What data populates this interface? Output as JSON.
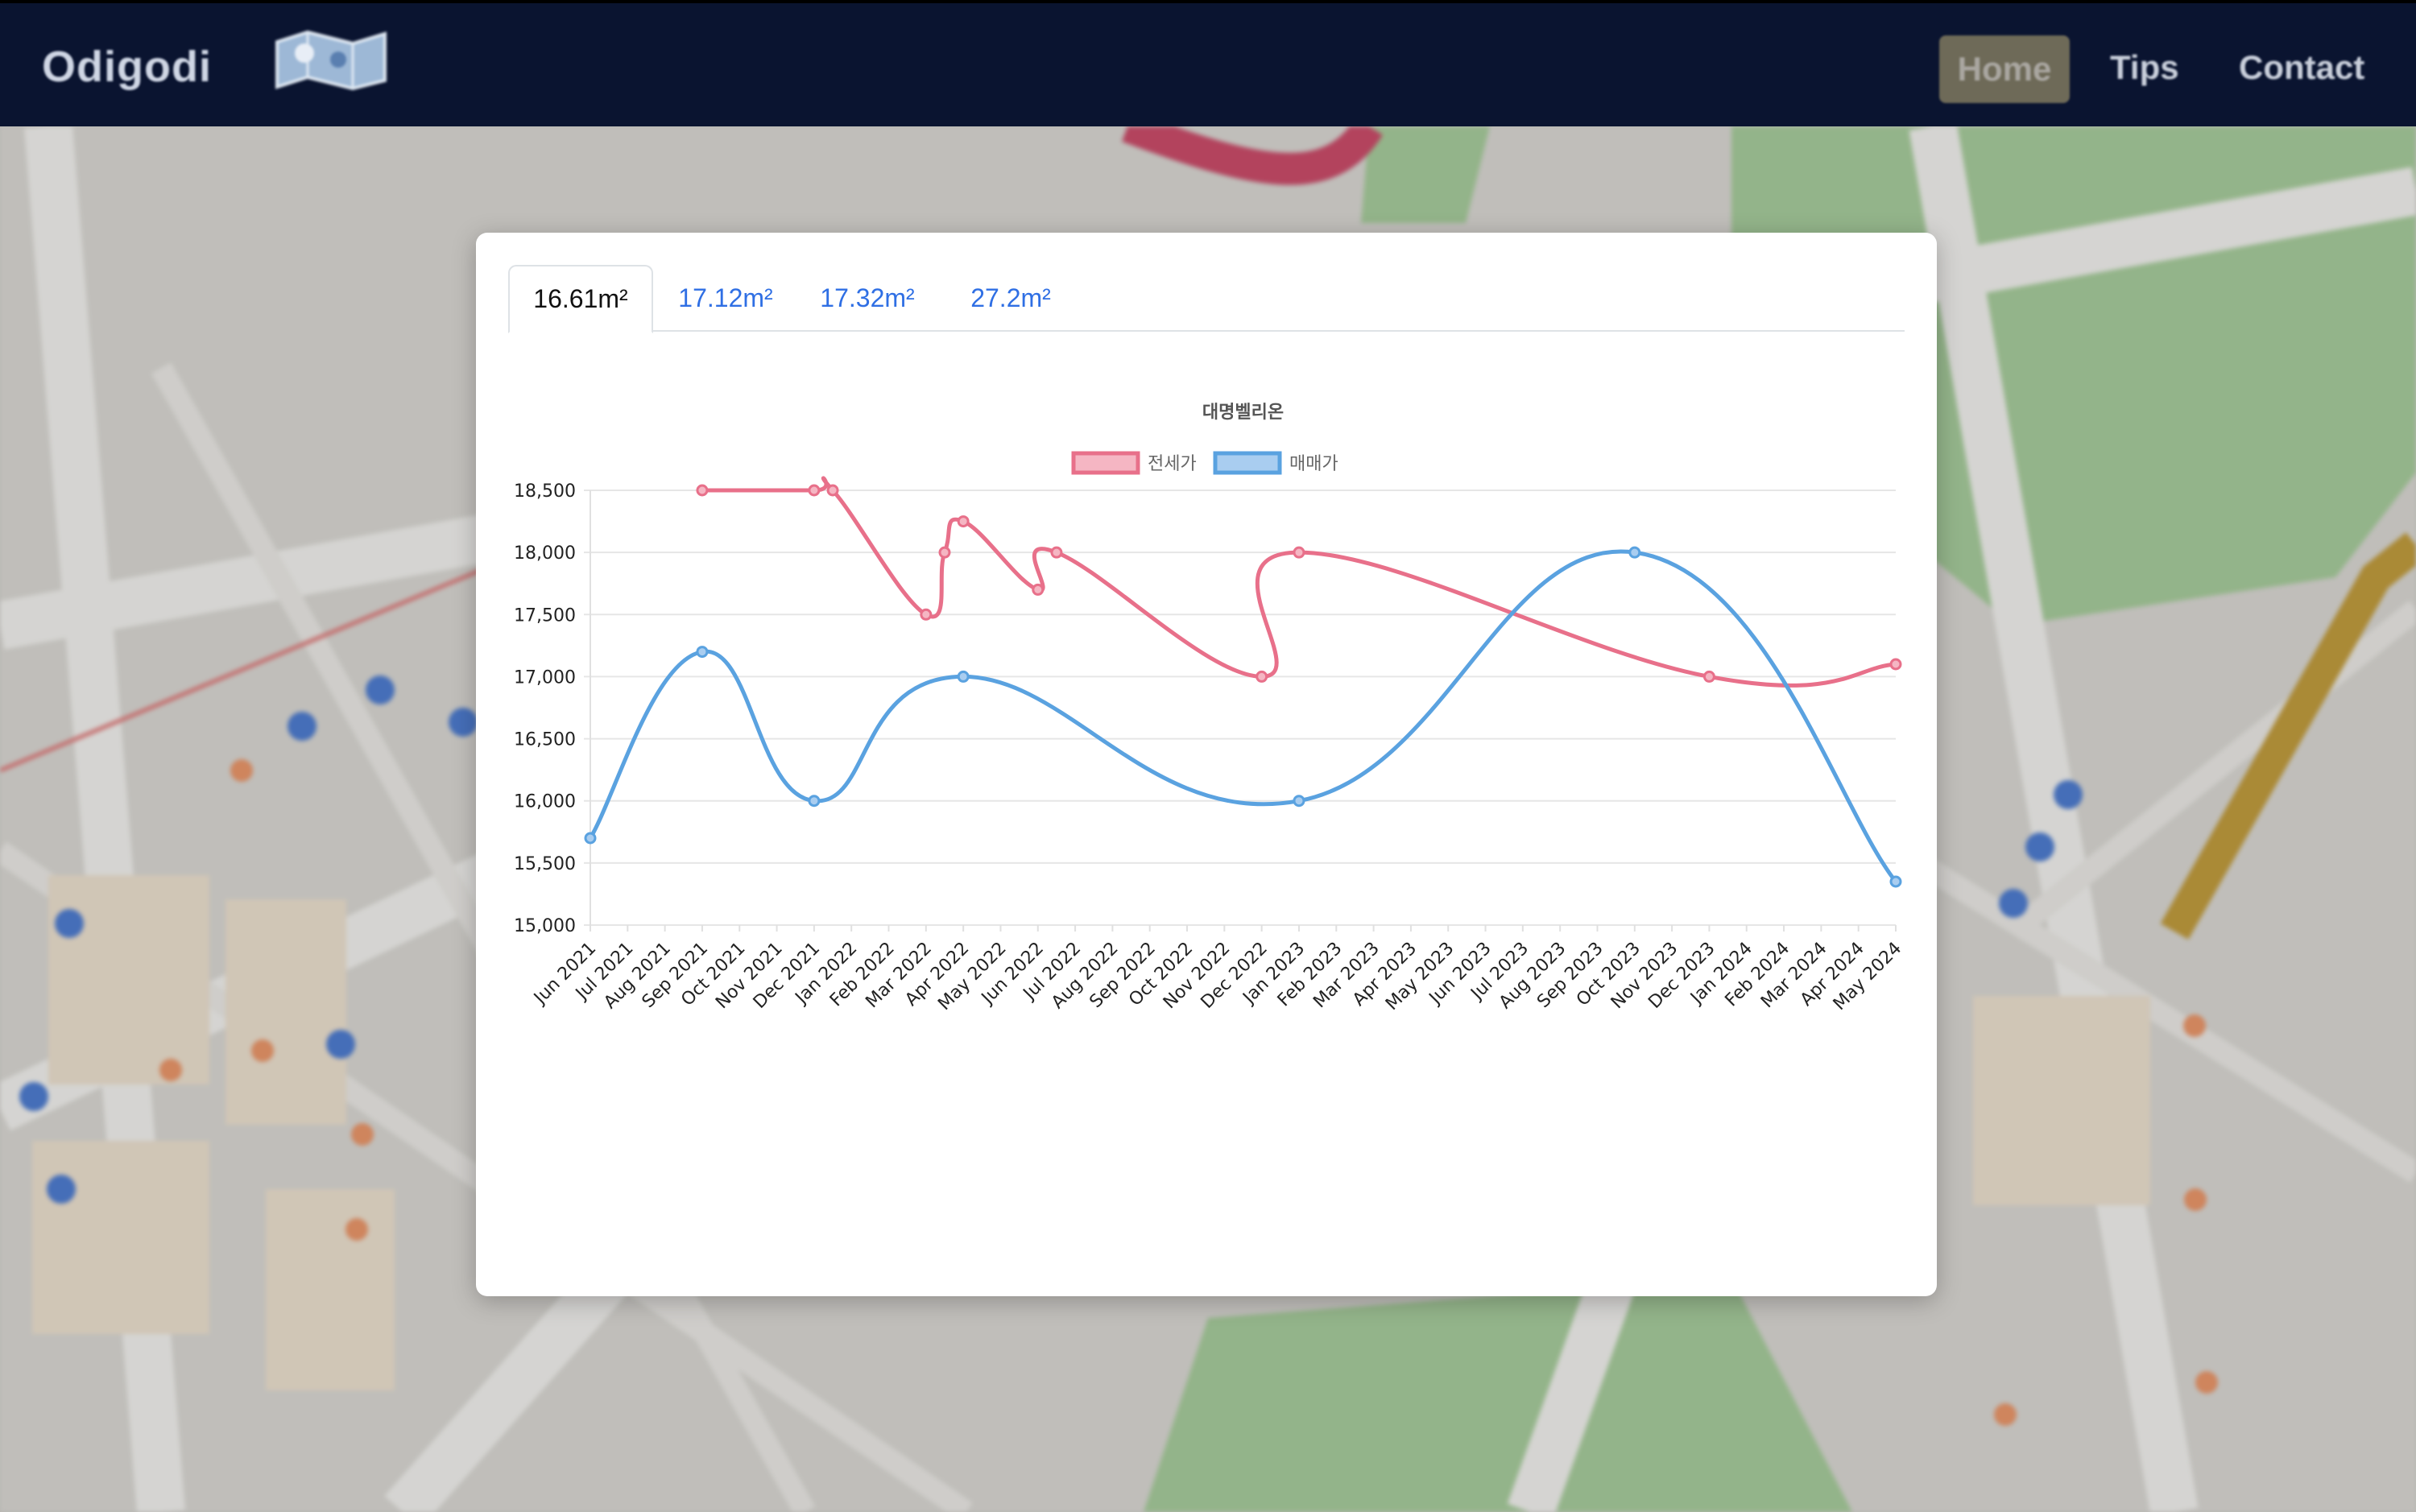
{
  "navbar": {
    "brand": "Odigodi",
    "links": [
      "Home",
      "Tips",
      "Contact"
    ]
  },
  "tabs": [
    "16.61m²",
    "17.12m²",
    "17.32m²",
    "27.2m²"
  ],
  "active_tab": 0,
  "colors": {
    "navbar_bg": "#0a1430",
    "jeonse": "#e8708a",
    "jeonse_fill": "#f5b6c3",
    "maemae": "#5aa2e0",
    "maemae_fill": "#a9cdf0",
    "tab_link": "#2f6fe4"
  },
  "icons": [
    "map-logo-icon",
    "map-pin-icon"
  ],
  "chart_data": {
    "type": "line",
    "title": "대명벨리온",
    "legend_position": "top-center",
    "grid": true,
    "categories": [
      "Jun 2021",
      "Jul 2021",
      "Aug 2021",
      "Sep 2021",
      "Oct 2021",
      "Nov 2021",
      "Dec 2021",
      "Jan 2022",
      "Feb 2022",
      "Mar 2022",
      "Apr 2022",
      "May 2022",
      "Jun 2022",
      "Jul 2022",
      "Aug 2022",
      "Sep 2022",
      "Oct 2022",
      "Nov 2022",
      "Dec 2022",
      "Jan 2023",
      "Feb 2023",
      "Mar 2023",
      "Apr 2023",
      "May 2023",
      "Jun 2023",
      "Jul 2023",
      "Aug 2023",
      "Sep 2023",
      "Oct 2023",
      "Nov 2023",
      "Dec 2023",
      "Jan 2024",
      "Feb 2024",
      "Mar 2024",
      "Apr 2024",
      "May 2024"
    ],
    "ylim": [
      15000,
      18500
    ],
    "yticks": [
      15000,
      15500,
      16000,
      16500,
      17000,
      17500,
      18000,
      18500
    ],
    "ytick_labels": [
      "15,000",
      "15,500",
      "16,000",
      "16,500",
      "17,000",
      "17,500",
      "18,000",
      "18,500"
    ],
    "series": [
      {
        "name": "전세가",
        "points": [
          {
            "x": "Sep 2021",
            "y": 18500
          },
          {
            "x": "Dec 2021",
            "y": 18500
          },
          {
            "x": "Dec 2021",
            "y": 18500
          },
          {
            "x": "Mar 2022",
            "y": 17500
          },
          {
            "x": "Mar 2022",
            "y": 18000
          },
          {
            "x": "Apr 2022",
            "y": 18250
          },
          {
            "x": "Jun 2022",
            "y": 17700
          },
          {
            "x": "Jun 2022",
            "y": 18000
          },
          {
            "x": "Dec 2022",
            "y": 17000
          },
          {
            "x": "Jan 2023",
            "y": 18000
          },
          {
            "x": "Dec 2023",
            "y": 17000
          },
          {
            "x": "May 2024",
            "y": 17100
          }
        ]
      },
      {
        "name": "매매가",
        "points": [
          {
            "x": "Jun 2021",
            "y": 15700
          },
          {
            "x": "Sep 2021",
            "y": 17200
          },
          {
            "x": "Dec 2021",
            "y": 16000
          },
          {
            "x": "Apr 2022",
            "y": 17000
          },
          {
            "x": "Jan 2023",
            "y": 16000
          },
          {
            "x": "Oct 2023",
            "y": 18000
          },
          {
            "x": "May 2024",
            "y": 15350
          }
        ]
      }
    ]
  }
}
